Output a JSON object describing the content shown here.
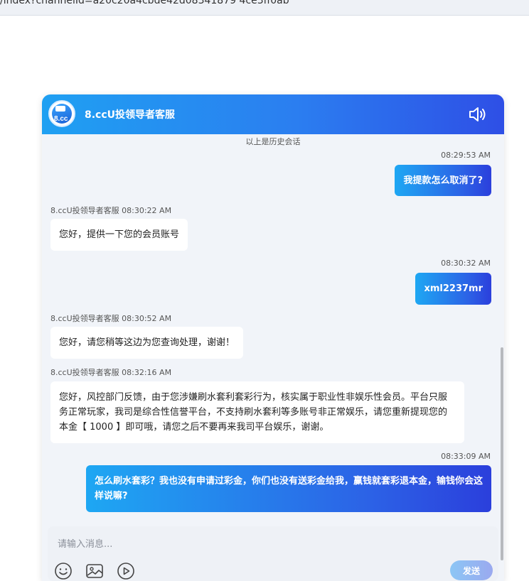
{
  "browser": {
    "url": "/index?channelId=a20c20a4cbde42d08341879 4ce3ff0ab"
  },
  "header": {
    "title": "8.ccU投领导者客服",
    "avatar_text": "8.cc"
  },
  "history_label": "以上是历史会话",
  "messages": [
    {
      "side": "out",
      "time": "08:29:53 AM",
      "text": "我提款怎么取消了?"
    },
    {
      "side": "in",
      "meta": "8.ccU投领导者客服 08:30:22 AM",
      "text": "您好，提供一下您的会员账号"
    },
    {
      "side": "out",
      "time": "08:30:32 AM",
      "text": "xml2237mr"
    },
    {
      "side": "in",
      "meta": "8.ccU投领导者客服 08:30:52 AM",
      "text": "您好，请您稍等这边为您查询处理，谢谢！"
    },
    {
      "side": "in",
      "meta": "8.ccU投领导者客服 08:32:16 AM",
      "text": "您好，风控部门反馈，由于您涉嫌刷水套利套彩行为，核实属于职业性非娱乐性会员。平台只服务正常玩家，我司是综合性信誉平台，不支持刷水套利等多账号非正常娱乐，请您重新提现您的本金【 1000 】即可哦，请您之后不要再来我司平台娱乐，谢谢。"
    },
    {
      "side": "out",
      "time": "08:33:09 AM",
      "text": "怎么刷水套彩？我也没有申请过彩金，你们也没有送彩金给我，赢钱就套彩退本金，输钱你会这样说嘛?"
    }
  ],
  "composer": {
    "placeholder": "请输入消息...",
    "send_label": "发送"
  },
  "icons": [
    "speaker-icon",
    "emoji-icon",
    "image-icon",
    "video-icon"
  ]
}
